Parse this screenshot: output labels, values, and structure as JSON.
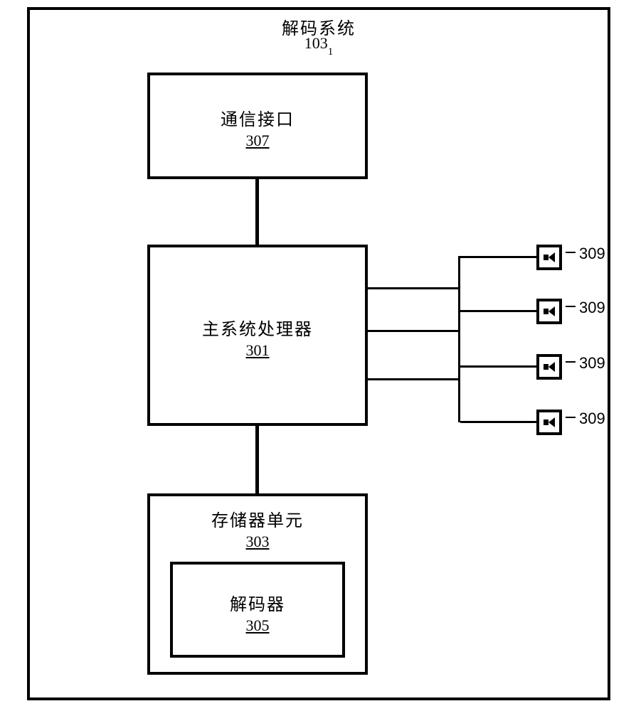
{
  "outer": {
    "title": "解码系统",
    "number": "103",
    "subscript": "1"
  },
  "comm": {
    "label": "通信接口",
    "number": "307"
  },
  "proc": {
    "label": "主系统处理器",
    "number": "301"
  },
  "mem": {
    "label": "存储器单元",
    "number": "303"
  },
  "dec": {
    "label": "解码器",
    "number": "305"
  },
  "speakers": [
    {
      "number": "309"
    },
    {
      "number": "309"
    },
    {
      "number": "309"
    },
    {
      "number": "309"
    }
  ]
}
